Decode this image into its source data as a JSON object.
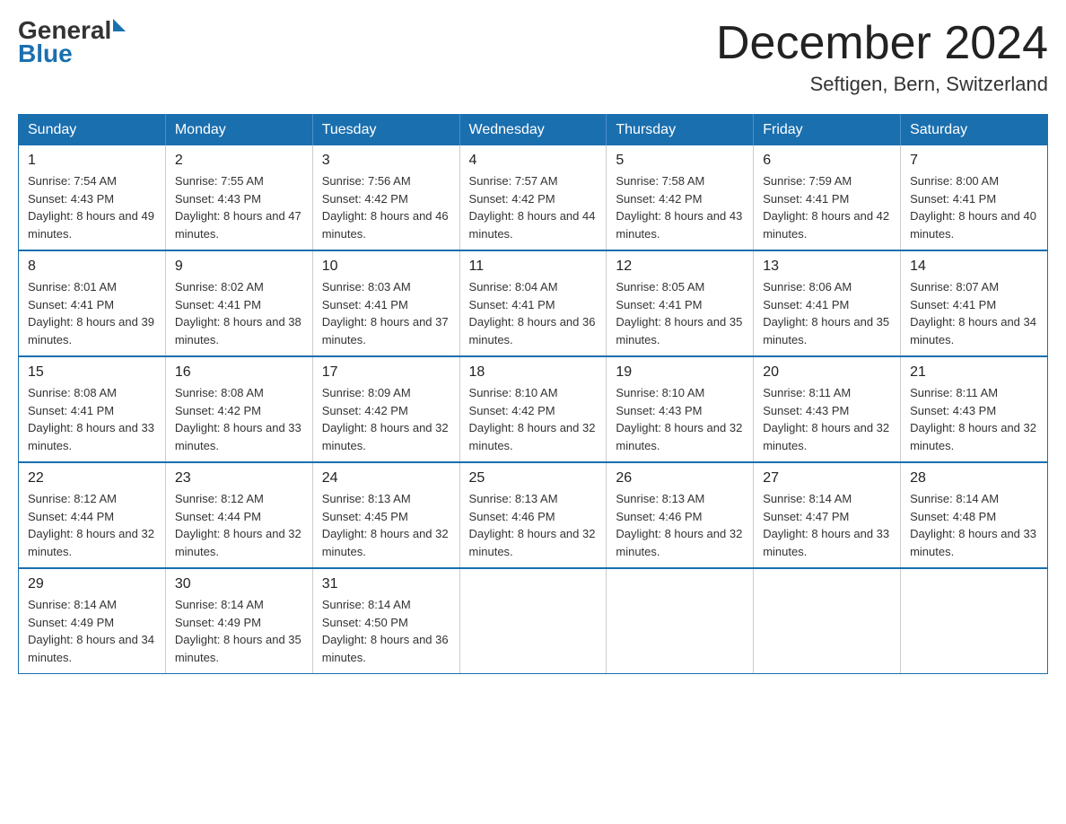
{
  "header": {
    "logo": {
      "general": "General",
      "blue": "Blue"
    },
    "title": "December 2024",
    "location": "Seftigen, Bern, Switzerland"
  },
  "days_of_week": [
    "Sunday",
    "Monday",
    "Tuesday",
    "Wednesday",
    "Thursday",
    "Friday",
    "Saturday"
  ],
  "weeks": [
    [
      {
        "day": "1",
        "sunrise": "7:54 AM",
        "sunset": "4:43 PM",
        "daylight": "8 hours and 49 minutes."
      },
      {
        "day": "2",
        "sunrise": "7:55 AM",
        "sunset": "4:43 PM",
        "daylight": "8 hours and 47 minutes."
      },
      {
        "day": "3",
        "sunrise": "7:56 AM",
        "sunset": "4:42 PM",
        "daylight": "8 hours and 46 minutes."
      },
      {
        "day": "4",
        "sunrise": "7:57 AM",
        "sunset": "4:42 PM",
        "daylight": "8 hours and 44 minutes."
      },
      {
        "day": "5",
        "sunrise": "7:58 AM",
        "sunset": "4:42 PM",
        "daylight": "8 hours and 43 minutes."
      },
      {
        "day": "6",
        "sunrise": "7:59 AM",
        "sunset": "4:41 PM",
        "daylight": "8 hours and 42 minutes."
      },
      {
        "day": "7",
        "sunrise": "8:00 AM",
        "sunset": "4:41 PM",
        "daylight": "8 hours and 40 minutes."
      }
    ],
    [
      {
        "day": "8",
        "sunrise": "8:01 AM",
        "sunset": "4:41 PM",
        "daylight": "8 hours and 39 minutes."
      },
      {
        "day": "9",
        "sunrise": "8:02 AM",
        "sunset": "4:41 PM",
        "daylight": "8 hours and 38 minutes."
      },
      {
        "day": "10",
        "sunrise": "8:03 AM",
        "sunset": "4:41 PM",
        "daylight": "8 hours and 37 minutes."
      },
      {
        "day": "11",
        "sunrise": "8:04 AM",
        "sunset": "4:41 PM",
        "daylight": "8 hours and 36 minutes."
      },
      {
        "day": "12",
        "sunrise": "8:05 AM",
        "sunset": "4:41 PM",
        "daylight": "8 hours and 35 minutes."
      },
      {
        "day": "13",
        "sunrise": "8:06 AM",
        "sunset": "4:41 PM",
        "daylight": "8 hours and 35 minutes."
      },
      {
        "day": "14",
        "sunrise": "8:07 AM",
        "sunset": "4:41 PM",
        "daylight": "8 hours and 34 minutes."
      }
    ],
    [
      {
        "day": "15",
        "sunrise": "8:08 AM",
        "sunset": "4:41 PM",
        "daylight": "8 hours and 33 minutes."
      },
      {
        "day": "16",
        "sunrise": "8:08 AM",
        "sunset": "4:42 PM",
        "daylight": "8 hours and 33 minutes."
      },
      {
        "day": "17",
        "sunrise": "8:09 AM",
        "sunset": "4:42 PM",
        "daylight": "8 hours and 32 minutes."
      },
      {
        "day": "18",
        "sunrise": "8:10 AM",
        "sunset": "4:42 PM",
        "daylight": "8 hours and 32 minutes."
      },
      {
        "day": "19",
        "sunrise": "8:10 AM",
        "sunset": "4:43 PM",
        "daylight": "8 hours and 32 minutes."
      },
      {
        "day": "20",
        "sunrise": "8:11 AM",
        "sunset": "4:43 PM",
        "daylight": "8 hours and 32 minutes."
      },
      {
        "day": "21",
        "sunrise": "8:11 AM",
        "sunset": "4:43 PM",
        "daylight": "8 hours and 32 minutes."
      }
    ],
    [
      {
        "day": "22",
        "sunrise": "8:12 AM",
        "sunset": "4:44 PM",
        "daylight": "8 hours and 32 minutes."
      },
      {
        "day": "23",
        "sunrise": "8:12 AM",
        "sunset": "4:44 PM",
        "daylight": "8 hours and 32 minutes."
      },
      {
        "day": "24",
        "sunrise": "8:13 AM",
        "sunset": "4:45 PM",
        "daylight": "8 hours and 32 minutes."
      },
      {
        "day": "25",
        "sunrise": "8:13 AM",
        "sunset": "4:46 PM",
        "daylight": "8 hours and 32 minutes."
      },
      {
        "day": "26",
        "sunrise": "8:13 AM",
        "sunset": "4:46 PM",
        "daylight": "8 hours and 32 minutes."
      },
      {
        "day": "27",
        "sunrise": "8:14 AM",
        "sunset": "4:47 PM",
        "daylight": "8 hours and 33 minutes."
      },
      {
        "day": "28",
        "sunrise": "8:14 AM",
        "sunset": "4:48 PM",
        "daylight": "8 hours and 33 minutes."
      }
    ],
    [
      {
        "day": "29",
        "sunrise": "8:14 AM",
        "sunset": "4:49 PM",
        "daylight": "8 hours and 34 minutes."
      },
      {
        "day": "30",
        "sunrise": "8:14 AM",
        "sunset": "4:49 PM",
        "daylight": "8 hours and 35 minutes."
      },
      {
        "day": "31",
        "sunrise": "8:14 AM",
        "sunset": "4:50 PM",
        "daylight": "8 hours and 36 minutes."
      },
      null,
      null,
      null,
      null
    ]
  ]
}
